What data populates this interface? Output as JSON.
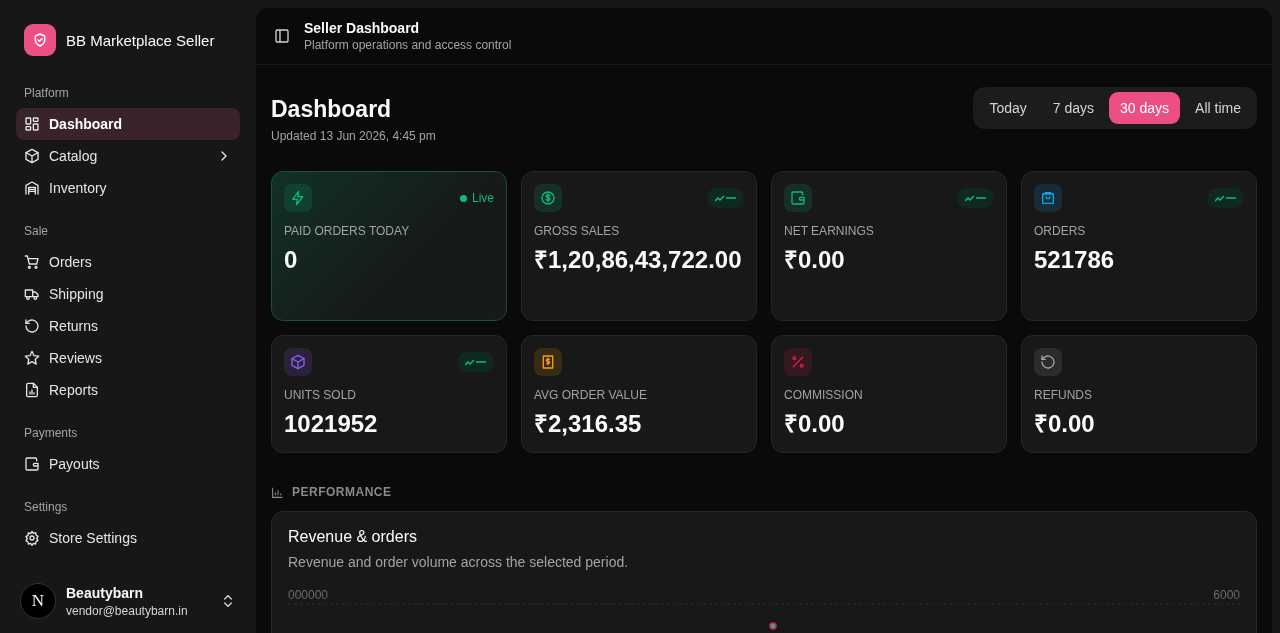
{
  "sidebar": {
    "brand": "BB Marketplace Seller",
    "sections": [
      {
        "title": "Platform",
        "items": [
          {
            "label": "Dashboard",
            "selected": true,
            "expandable": false
          },
          {
            "label": "Catalog",
            "selected": false,
            "expandable": true
          },
          {
            "label": "Inventory",
            "selected": false,
            "expandable": false
          }
        ]
      },
      {
        "title": "Sale",
        "items": [
          {
            "label": "Orders",
            "selected": false,
            "expandable": false
          },
          {
            "label": "Shipping",
            "selected": false,
            "expandable": false
          },
          {
            "label": "Returns",
            "selected": false,
            "expandable": false
          },
          {
            "label": "Reviews",
            "selected": false,
            "expandable": false
          },
          {
            "label": "Reports",
            "selected": false,
            "expandable": false
          }
        ]
      },
      {
        "title": "Payments",
        "items": [
          {
            "label": "Payouts",
            "selected": false,
            "expandable": false
          }
        ]
      },
      {
        "title": "Settings",
        "items": [
          {
            "label": "Store Settings",
            "selected": false,
            "expandable": false
          }
        ]
      }
    ],
    "user": {
      "name": "Beautybarn",
      "email": "vendor@beautybarn.in",
      "avatar": "N"
    }
  },
  "header": {
    "title": "Seller Dashboard",
    "subtitle": "Platform operations and access control"
  },
  "page": {
    "title": "Dashboard",
    "updated": "Updated 13 Jun 2026, 4:45 pm"
  },
  "periods": [
    {
      "label": "Today",
      "selected": false
    },
    {
      "label": "7 days",
      "selected": false
    },
    {
      "label": "30 days",
      "selected": true
    },
    {
      "label": "All time",
      "selected": false
    }
  ],
  "stats": [
    {
      "kind": "live",
      "label": "PAID ORDERS TODAY",
      "value": "0",
      "badge": "Live",
      "color": "#10b981"
    },
    {
      "kind": "trend",
      "label": "GROSS SALES",
      "value": "₹1,20,86,43,722.00",
      "color": "#10b981"
    },
    {
      "kind": "trend",
      "label": "NET EARNINGS",
      "value": "₹0.00",
      "color": "#10b981"
    },
    {
      "kind": "trend",
      "label": "ORDERS",
      "value": "521786",
      "color": "#0ea5e9"
    },
    {
      "kind": "trend",
      "label": "UNITS SOLD",
      "value": "1021952",
      "color": "#8b5cf6"
    },
    {
      "kind": "plain",
      "label": "AVG ORDER VALUE",
      "value": "₹2,316.35",
      "color": "#f59e0b"
    },
    {
      "kind": "plain",
      "label": "COMMISSION",
      "value": "₹0.00",
      "color": "#e11d48"
    },
    {
      "kind": "plain",
      "label": "REFUNDS",
      "value": "₹0.00",
      "color": "#a3a3a3"
    }
  ],
  "performance": {
    "section_title": "PERFORMANCE",
    "card_title": "Revenue & orders",
    "card_subtitle": "Revenue and order volume across the selected period.",
    "left_axis_label": "000000",
    "right_axis_label": "6000"
  }
}
